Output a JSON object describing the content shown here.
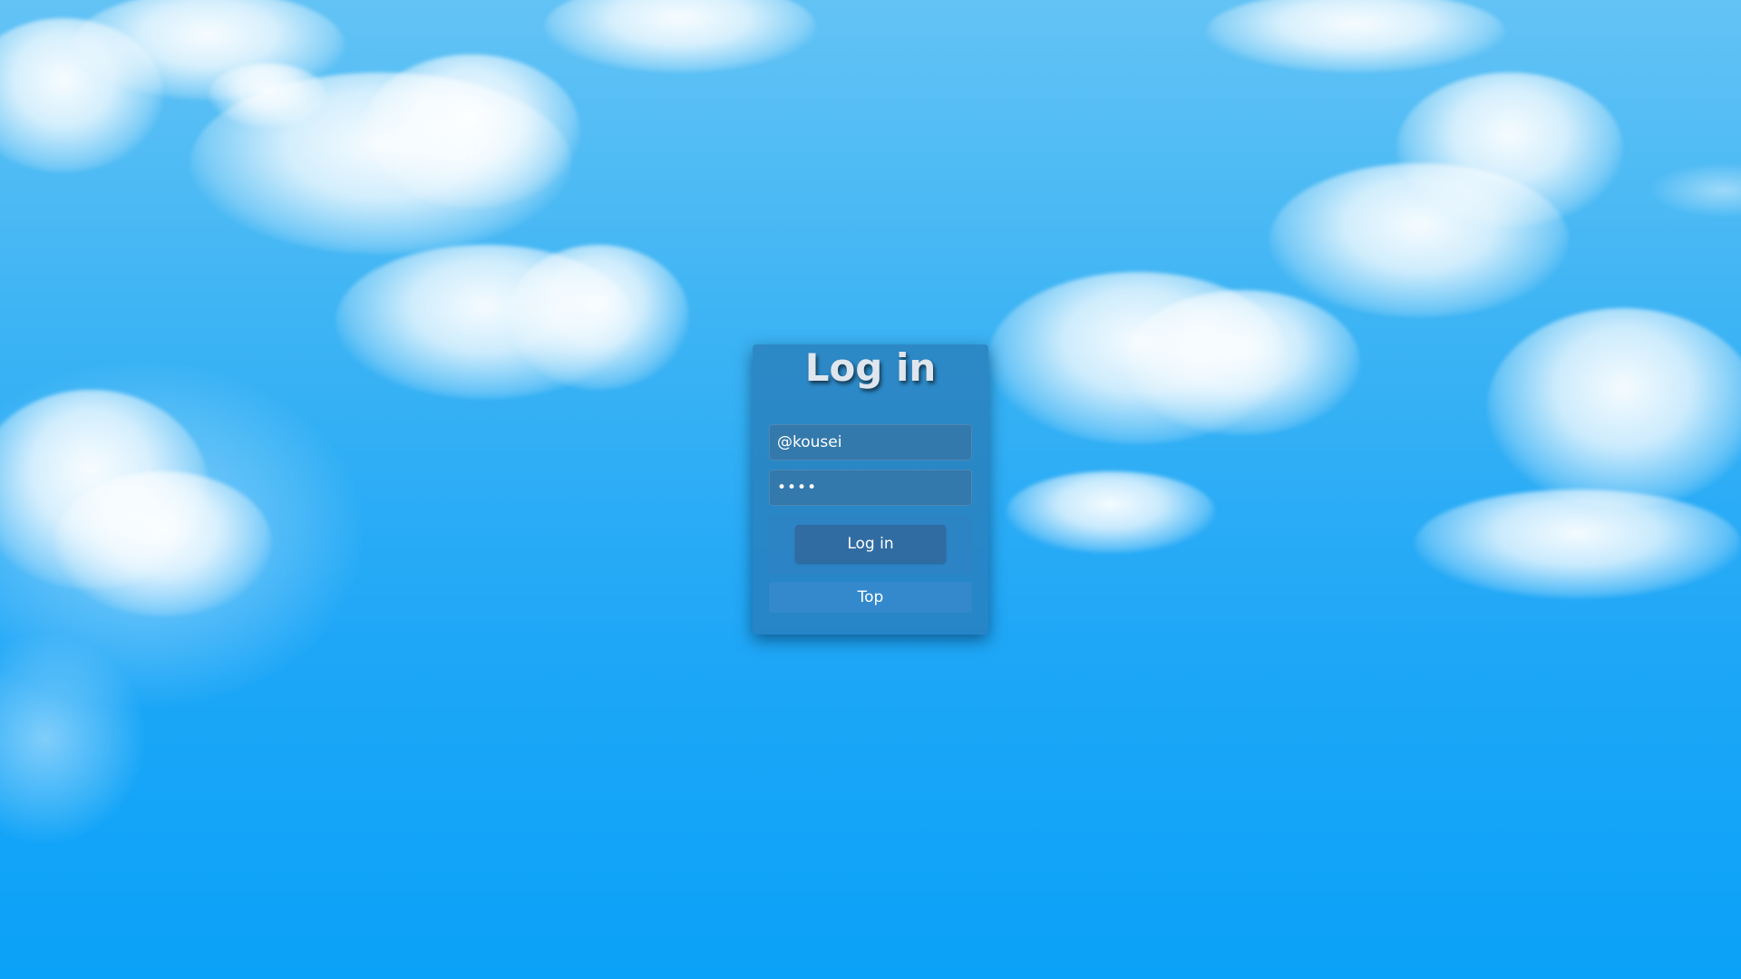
{
  "page": {
    "title": "Log in"
  },
  "form": {
    "username_value": "@kousei",
    "password_value": "abcd",
    "login_label": "Log in",
    "top_label": "Top"
  },
  "colors": {
    "sky_top": "#63c3f5",
    "sky_bottom": "#0aa2f8",
    "panel": "#2878b4",
    "button": "#326496"
  }
}
